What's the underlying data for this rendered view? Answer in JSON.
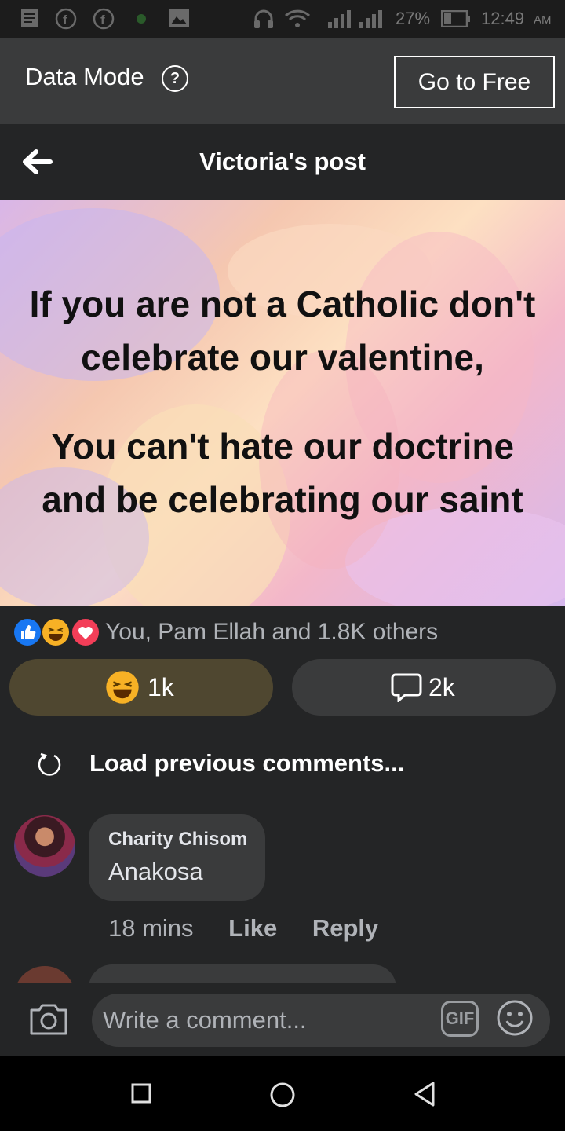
{
  "status_bar": {
    "battery": "27%",
    "time": "12:49",
    "ampm": "AM"
  },
  "data_bar": {
    "label": "Data Mode",
    "help_glyph": "?",
    "button": "Go to Free"
  },
  "header": {
    "title": "Victoria's post"
  },
  "post": {
    "line1": "If you are not a Catholic don't",
    "line2": "celebrate our valentine,",
    "line3": "You can't hate our doctrine",
    "line4": "and be celebrating our saint"
  },
  "reactions": {
    "icons": [
      "like-icon",
      "haha-icon",
      "love-icon"
    ],
    "summary": "You, Pam Ellah and 1.8K others"
  },
  "actions": {
    "haha_count": "1k",
    "comment_count": "2k"
  },
  "load_previous": "Load previous comments...",
  "comment": {
    "author": "Charity Chisom",
    "text": "Anakosa",
    "time": "18 mins",
    "like": "Like",
    "reply": "Reply"
  },
  "composer": {
    "placeholder": "Write a comment...",
    "gif": "GIF"
  },
  "colors": {
    "background": "#242526",
    "bubble": "#3a3b3c",
    "haha_pill": "#4f4730",
    "like_blue": "#1877f2",
    "love_red": "#f33e58"
  }
}
